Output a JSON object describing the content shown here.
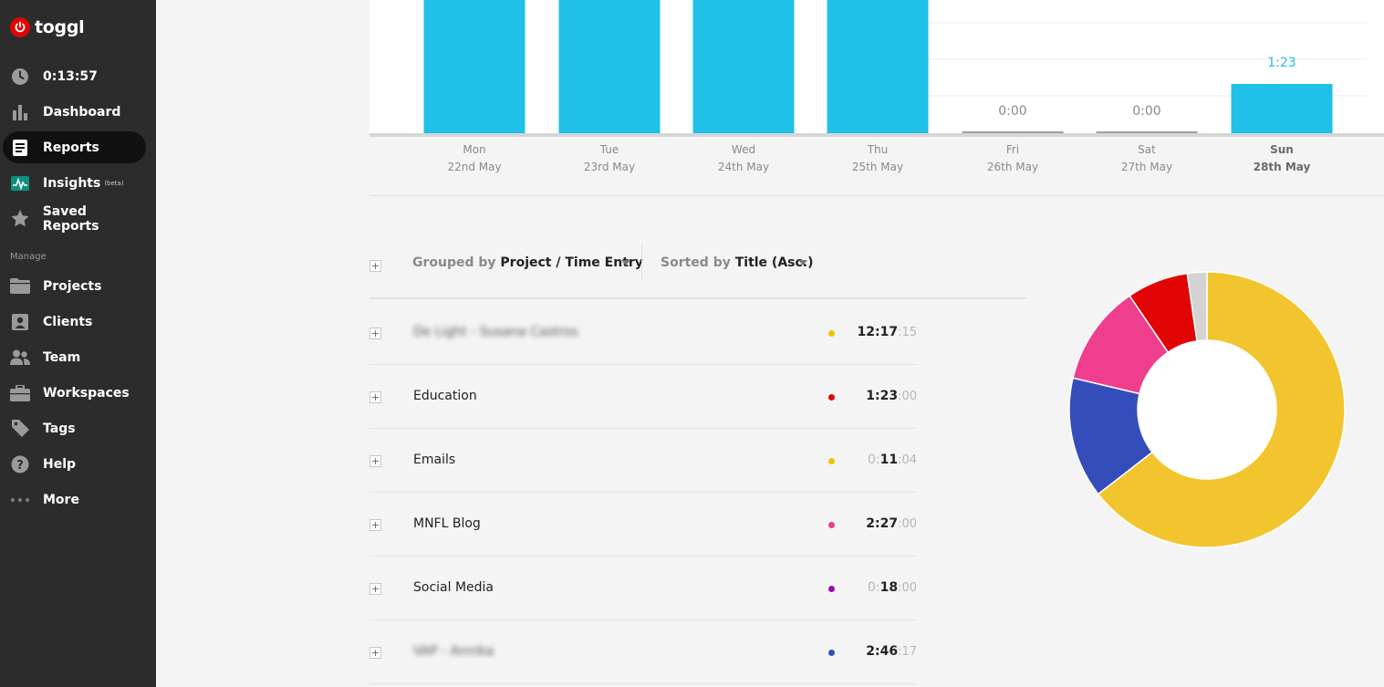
{
  "brand": {
    "name": "toggl",
    "color": "#e20505"
  },
  "sidebar": {
    "timer": "0:13:57",
    "items": [
      {
        "label": "Dashboard",
        "icon": "bar-chart-icon"
      },
      {
        "label": "Reports",
        "icon": "report-icon",
        "active": true
      },
      {
        "label": "Insights",
        "badge": "(beta)",
        "icon": "insights-icon"
      },
      {
        "label": "Saved Reports",
        "icon": "star-icon"
      }
    ],
    "manage_label": "Manage",
    "manage_items": [
      {
        "label": "Projects",
        "icon": "folder-icon"
      },
      {
        "label": "Clients",
        "icon": "client-icon"
      },
      {
        "label": "Team",
        "icon": "team-icon"
      },
      {
        "label": "Workspaces",
        "icon": "briefcase-icon"
      },
      {
        "label": "Tags",
        "icon": "tag-icon"
      },
      {
        "label": "Help",
        "icon": "help-icon"
      },
      {
        "label": "More",
        "icon": "more-icon"
      }
    ]
  },
  "chart_data": {
    "type": "bar",
    "categories": [
      "Mon 22nd May",
      "Tue 23rd May",
      "Wed 24th May",
      "Thu 25th May",
      "Fri 26th May",
      "Sat 27th May",
      "Sun 28th May"
    ],
    "day_names": [
      "Mon",
      "Tue",
      "Wed",
      "Thu",
      "Fri",
      "Sat",
      "Sun"
    ],
    "dates": [
      "22nd May",
      "23rd May",
      "24th May",
      "25th May",
      "26th May",
      "27th May",
      "28th May"
    ],
    "highlight_index": 6,
    "value_labels": [
      "",
      "",
      "",
      "",
      "0:00",
      "0:00",
      "1:23"
    ],
    "bar_color": "#1fc1e8",
    "zero_color": "#9e9e9e"
  },
  "toolbar": {
    "grouped_label": "Grouped by",
    "grouped_value": "Project / Time Entry",
    "sorted_label": "Sorted by",
    "sorted_value": "Title (Asc.)"
  },
  "rows": [
    {
      "title": "De Light - Susana Castros",
      "blurred": true,
      "color": "#f2c200",
      "time_dim": "",
      "time_main": "12:17",
      "time_sec": "15"
    },
    {
      "title": "Education",
      "blurred": false,
      "color": "#e20505",
      "time_dim": "",
      "time_main": "1:23",
      "time_sec": "00"
    },
    {
      "title": "Emails",
      "blurred": false,
      "color": "#f2c200",
      "time_dim": "0:",
      "time_main": "11",
      "time_sec": "04"
    },
    {
      "title": "MNFL Blog",
      "blurred": false,
      "color": "#ef3e8e",
      "time_dim": "",
      "time_main": "2:27",
      "time_sec": "00"
    },
    {
      "title": "Social Media",
      "blurred": false,
      "color": "#9c0aa8",
      "time_dim": "0:",
      "time_main": "18",
      "time_sec": "00"
    },
    {
      "title": "VAP - Annika",
      "blurred": true,
      "color": "#354dbb",
      "time_dim": "",
      "time_main": "2:46",
      "time_sec": "17"
    }
  ],
  "donut_data": {
    "type": "pie",
    "slices": [
      {
        "color": "#f2c42e",
        "value": 64.5
      },
      {
        "color": "#354dbb",
        "value": 14.2
      },
      {
        "color": "#ef3e8e",
        "value": 11.8
      },
      {
        "color": "#e20505",
        "value": 7.2
      },
      {
        "color": "#d3d3d3",
        "value": 2.3
      }
    ]
  }
}
